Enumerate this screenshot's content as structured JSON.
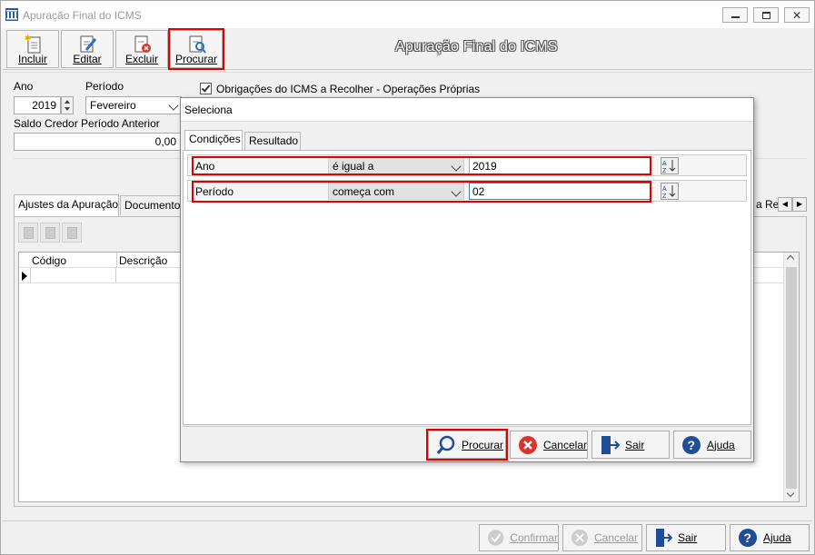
{
  "window": {
    "title": "Apuração Final do ICMS"
  },
  "toolbar": {
    "incluir": "Incluir",
    "editar": "Editar",
    "excluir": "Excluir",
    "procurar": "Procurar",
    "heading": "Apuração Final do ICMS"
  },
  "form": {
    "ano_label": "Ano",
    "ano_value": "2019",
    "periodo_label": "Período",
    "periodo_value": "Fevereiro",
    "saldo_label": "Saldo Credor Período Anterior",
    "saldo_value": "0,00",
    "obrigacoes_label": "Obrigações do ICMS a Recolher - Operações Próprias",
    "obrigacoes_checked": true
  },
  "tabs": {
    "ajustes": "Ajustes da Apuração",
    "documentos": "Documentos",
    "right_partial": "a Rec"
  },
  "grid": {
    "col_codigo": "Código",
    "col_descricao": "Descrição"
  },
  "bottom": {
    "confirmar": "Confirmar",
    "cancelar": "Cancelar",
    "sair": "Sair",
    "ajuda": "Ajuda"
  },
  "dialog": {
    "title": "Seleciona",
    "tab_condicoes": "Condições",
    "tab_resultado": "Resultado",
    "conditions": [
      {
        "field": "Ano",
        "operator": "é igual a",
        "value": "2019"
      },
      {
        "field": "Período",
        "operator": "começa com",
        "value": "02"
      }
    ],
    "buttons": {
      "procurar": "Procurar",
      "cancelar": "Cancelar",
      "sair": "Sair",
      "ajuda": "Ajuda"
    }
  },
  "colors": {
    "highlight": "#e00000",
    "icon_blue": "#1f4e96",
    "cancel_red": "#d9342b"
  }
}
